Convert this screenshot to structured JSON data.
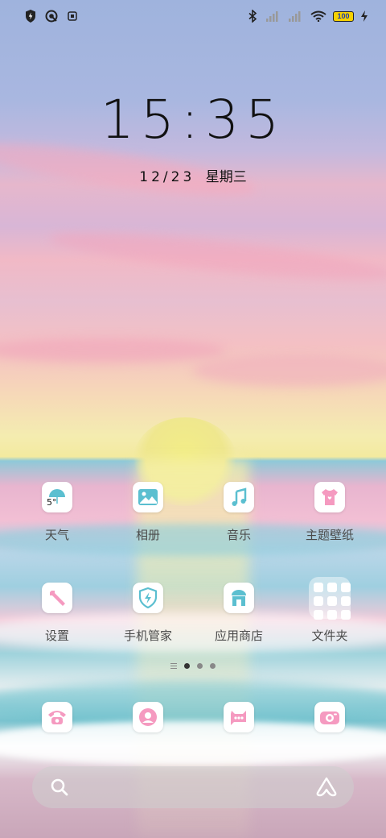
{
  "status_bar": {
    "battery": "100",
    "left_icons": [
      "shield-bolt-icon",
      "target-icon",
      "app-notification-icon"
    ],
    "right_icons": [
      "bluetooth-icon",
      "signal-1-icon",
      "signal-2-icon",
      "wifi-icon",
      "battery-icon",
      "charging-icon"
    ]
  },
  "lock": {
    "time": "15:35",
    "date": "12/23",
    "weekday": "星期三"
  },
  "apps": {
    "row1": [
      {
        "label": "天气",
        "icon": "weather-icon",
        "badge": "5°"
      },
      {
        "label": "相册",
        "icon": "photos-icon"
      },
      {
        "label": "音乐",
        "icon": "music-icon"
      },
      {
        "label": "主题壁纸",
        "icon": "themes-icon"
      }
    ],
    "row2": [
      {
        "label": "设置",
        "icon": "settings-icon"
      },
      {
        "label": "手机管家",
        "icon": "phone-manager-icon"
      },
      {
        "label": "应用商店",
        "icon": "app-store-icon"
      },
      {
        "label": "文件夹",
        "icon": "folder-icon"
      }
    ]
  },
  "dock": [
    "phone-icon",
    "contacts-icon",
    "messages-icon",
    "camera-icon"
  ],
  "page_indicator": {
    "pages": 3,
    "active": 1
  },
  "colors": {
    "icon_accent": "#5bbfd0",
    "pink_accent": "#f59ac0"
  }
}
